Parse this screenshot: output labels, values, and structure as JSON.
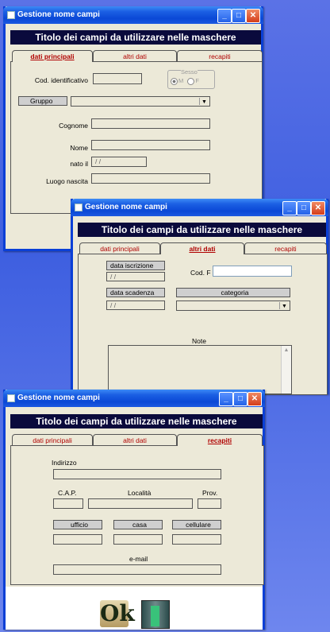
{
  "window_title": "Gestione nome campi",
  "banner": "Titolo dei campi da utilizzare nelle maschere",
  "tabs": [
    "dati principali",
    "altri dati",
    "recapiti"
  ],
  "w1": {
    "cod_label": "Cod. identificativo",
    "sesso_label": "Sesso",
    "sesso_m": "M",
    "sesso_f": "F",
    "gruppo": "Gruppo",
    "cognome": "Cognome",
    "nome": "Nome",
    "nato_il": "nato il",
    "date_placeholder": " /  /",
    "luogo": "Luogo nascita"
  },
  "w2": {
    "data_iscrizione": "data iscrizione",
    "date1": " /  /",
    "cod_f": "Cod. F",
    "data_scadenza": "data scadenza",
    "categoria": "categoria",
    "date2": " /  /",
    "note": "Note"
  },
  "w3": {
    "indirizzo": "Indirizzo",
    "cap": "C.A.P.",
    "localita": "Località",
    "prov": "Prov.",
    "ufficio": "ufficio",
    "casa": "casa",
    "cellulare": "cellulare",
    "email": "e-mail"
  },
  "icons": {
    "ok": "Ok"
  }
}
